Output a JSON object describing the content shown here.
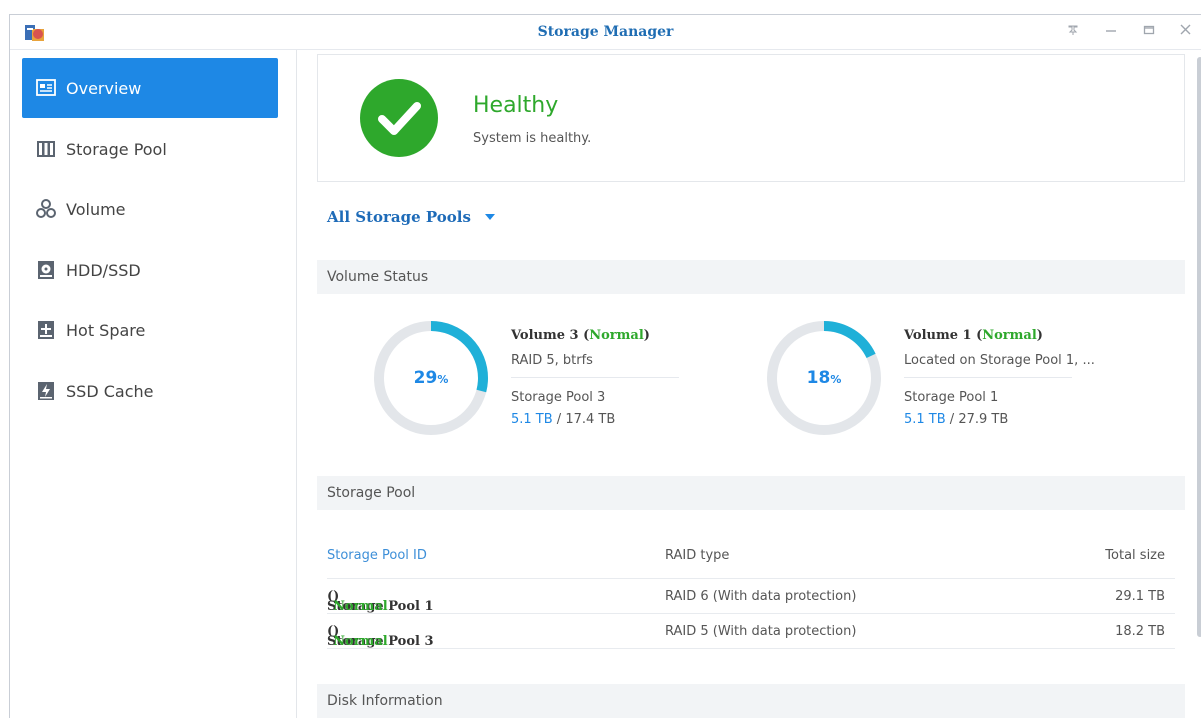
{
  "window": {
    "title": "Storage Manager"
  },
  "sidebar": {
    "items": [
      {
        "label": "Overview",
        "icon": "overview-icon",
        "active": true
      },
      {
        "label": "Storage Pool",
        "icon": "storage-pool-icon"
      },
      {
        "label": "Volume",
        "icon": "volume-icon"
      },
      {
        "label": "HDD/SSD",
        "icon": "hdd-icon"
      },
      {
        "label": "Hot Spare",
        "icon": "hot-spare-icon"
      },
      {
        "label": "SSD Cache",
        "icon": "ssd-cache-icon"
      }
    ]
  },
  "health": {
    "status": "Healthy",
    "message": "System is healthy.",
    "icon": "checkmark-icon",
    "color": "#2ea82c"
  },
  "filter": {
    "label": "All Storage Pools"
  },
  "sections": {
    "volume_status": "Volume Status",
    "storage_pool": "Storage Pool",
    "disk_information": "Disk Information"
  },
  "volumes": [
    {
      "name": "Volume 3",
      "status": "Normal",
      "percent": 29,
      "percent_unit": "%",
      "description": "RAID 5, btrfs",
      "pool": "Storage Pool 3",
      "used": "5.1 TB",
      "total": "17.4 TB"
    },
    {
      "name": "Volume 1",
      "status": "Normal",
      "percent": 18,
      "percent_unit": "%",
      "description": "Located on Storage Pool 1, ...",
      "pool": "Storage Pool 1",
      "used": "5.1 TB",
      "total": "27.9 TB"
    }
  ],
  "pool_table": {
    "headers": [
      "Storage Pool ID",
      "RAID type",
      "Total size"
    ],
    "rows": [
      {
        "id": "Storage Pool 1",
        "status": "Normal",
        "raid": "RAID 6 (With data protection)",
        "size": "29.1 TB"
      },
      {
        "id": "Storage Pool 3",
        "status": "Normal",
        "raid": "RAID 5 (With data protection)",
        "size": "18.2 TB"
      }
    ]
  },
  "colors": {
    "accent": "#1e88e5",
    "healthy": "#2ea82c",
    "donut_track": "#e3e6ea",
    "donut_fill": "#1fb0d8"
  }
}
